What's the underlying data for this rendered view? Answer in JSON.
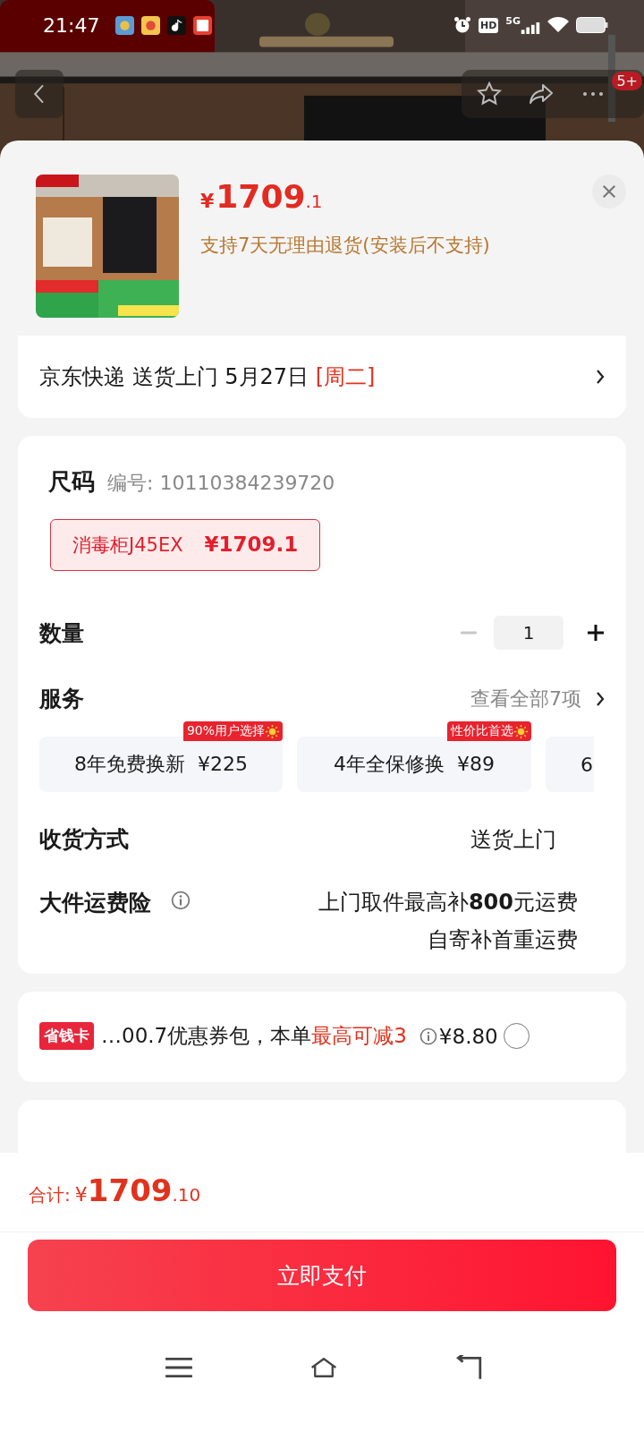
{
  "status_bar": {
    "time": "21:47",
    "hd": "HD",
    "network": "5G"
  },
  "nav": {
    "badge": "5+"
  },
  "product": {
    "price_main": "¥1709",
    "price_decimal": ".1",
    "return_policy": "支持7天无理由退货(安装后不支持)"
  },
  "delivery": {
    "text": "京东快递 送货上门 5月27日",
    "weekday": "[周二]"
  },
  "spec": {
    "label": "尺码",
    "code": "编号: 10110384239720",
    "options": [
      {
        "name": "消毒柜J45EX",
        "price": "¥1709.1",
        "selected": true
      }
    ]
  },
  "quantity": {
    "label": "数量",
    "value": "1",
    "decrement_disabled": true
  },
  "services": {
    "label": "服务",
    "view_all": "查看全部7项",
    "options": [
      {
        "name": "8年免费换新",
        "price": "¥225",
        "tag": "90%用户选择",
        "selected": false
      },
      {
        "name": "4年全保修换",
        "price": "¥89",
        "tag": "性价比首选",
        "selected": false
      },
      {
        "name": "6",
        "selected": false
      }
    ]
  },
  "receiving": {
    "label": "收货方式",
    "value": "送货上门"
  },
  "insurance": {
    "label": "大件运费险",
    "lines": [
      "上门取件最高补**800**元运费",
      "自寄补首重运费"
    ]
  },
  "coupon": {
    "badge": "省钱卡",
    "text": "…00.7优惠券包，本单",
    "highlight": "最高可减3",
    "price": "¥8.80",
    "checked": false
  },
  "footer": {
    "total_label": "合计:",
    "currency": "¥",
    "total_main": "1709",
    "total_decimal": ".10",
    "pay_button": "立即支付"
  }
}
